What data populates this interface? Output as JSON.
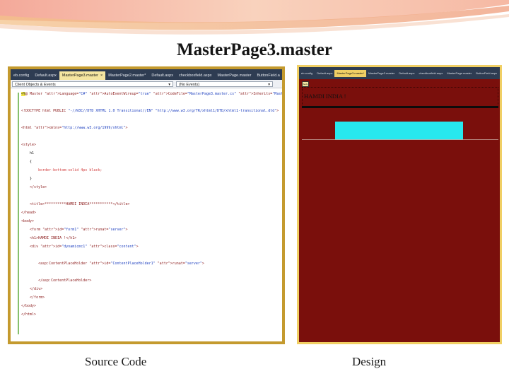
{
  "slide": {
    "title": "MasterPage3.master",
    "caption_source": "Source Code",
    "caption_design": "Design"
  },
  "editor": {
    "tabs": [
      {
        "label": "eb.config",
        "active": false
      },
      {
        "label": "Default.aspx",
        "active": false
      },
      {
        "label": "MasterPage3.master",
        "active": true,
        "close": "×"
      },
      {
        "label": "MasterPage2.master*",
        "active": false
      },
      {
        "label": "Default.aspx",
        "active": false
      },
      {
        "label": "checkboxfield.aspx",
        "active": false
      },
      {
        "label": "MasterPage.master",
        "active": false
      },
      {
        "label": "ButtonField.a",
        "active": false
      }
    ],
    "dropdown_left": "Client Objects & Events",
    "dropdown_right": "(No Events)",
    "dropdown_arrow": "▾",
    "code": [
      {
        "t": "%@ Master Language=\"C#\" AutoEventWireup=\"true\" CodeFile=\"MasterPage3.master.cs\" Inherits=\"MasterPage3\" %"
      },
      {
        "t": ""
      },
      {
        "t": "<!DOCTYPE html PUBLIC \"-//W3C//DTD XHTML 1.0 Transitional//EN\" \"http://www.w3.org/TR/xhtml1/DTD/xhtml1-transitional.dtd\">"
      },
      {
        "t": ""
      },
      {
        "t": "<html xmlns=\"http://www.w3.org/1999/xhtml\">"
      },
      {
        "t": ""
      },
      {
        "t": "<style>"
      },
      {
        "t": "    h1"
      },
      {
        "t": "    {"
      },
      {
        "t": "        border-bottom:solid 4px black;"
      },
      {
        "t": "    }"
      },
      {
        "t": "    </style>"
      },
      {
        "t": ""
      },
      {
        "t": "    <title>**********HAMDI INDIA***********</title>"
      },
      {
        "t": "</head>"
      },
      {
        "t": "<body>"
      },
      {
        "t": "    <form id=\"form1\" runat=\"server\">"
      },
      {
        "t": "    <h1>HAMDI INDIA !</h1>"
      },
      {
        "t": "    <div id=\"dynamicmc1\" class=\"content\">"
      },
      {
        "t": ""
      },
      {
        "t": "        <asp:ContentPlaceHolder id=\"ContentPlaceHolder1\" runat=\"server\">"
      },
      {
        "t": ""
      },
      {
        "t": "        </asp:ContentPlaceHolder>"
      },
      {
        "t": "    </div>"
      },
      {
        "t": "    </form>"
      },
      {
        "t": "</body>"
      },
      {
        "t": "</html>"
      }
    ]
  },
  "designer": {
    "tabs": [
      {
        "label": "eb.config",
        "active": false
      },
      {
        "label": "Default.aspx",
        "active": false
      },
      {
        "label": "MasterPage3.master*",
        "active": true
      },
      {
        "label": "MasterPage2.master",
        "active": false
      },
      {
        "label": "Default.aspx",
        "active": false
      },
      {
        "label": "checkboxfield.aspx",
        "active": false
      },
      {
        "label": "MasterPage.master",
        "active": false
      },
      {
        "label": "ButtonField.aspx",
        "active": false
      }
    ],
    "tag_label": "body",
    "heading": "HAMDI INDIA !"
  },
  "colors": {
    "editor_frame": "#c49a2e",
    "design_frame": "#f0cf64",
    "design_background": "#7a0f0c",
    "placeholder": "#27e8ee"
  }
}
